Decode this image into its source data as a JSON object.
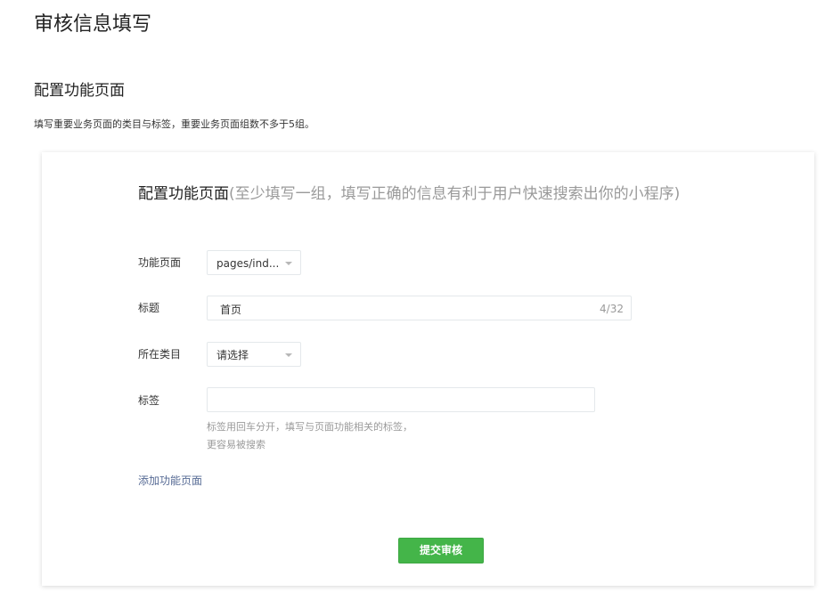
{
  "page": {
    "title": "审核信息填写"
  },
  "section": {
    "title": "配置功能页面",
    "description": "填写重要业务页面的类目与标签，重要业务页面组数不多于5组。"
  },
  "card": {
    "heading": "配置功能页面",
    "heading_hint": "(至少填写一组，填写正确的信息有利于用户快速搜索出你的小程序)",
    "fields": {
      "page": {
        "label": "功能页面",
        "value": "pages/ind..."
      },
      "title": {
        "label": "标题",
        "value": "首页",
        "counter": "4/32"
      },
      "category": {
        "label": "所在类目",
        "value": "请选择"
      },
      "tags": {
        "label": "标签",
        "value": "",
        "tips_line1": "标签用回车分开，填写与页面功能相关的标签，",
        "tips_line2": "更容易被搜索"
      }
    },
    "add_link": "添加功能页面",
    "submit_label": "提交审核"
  },
  "colors": {
    "accent_green": "#44b549",
    "link_blue": "#576b95",
    "hint_gray": "#9a9a9a"
  }
}
